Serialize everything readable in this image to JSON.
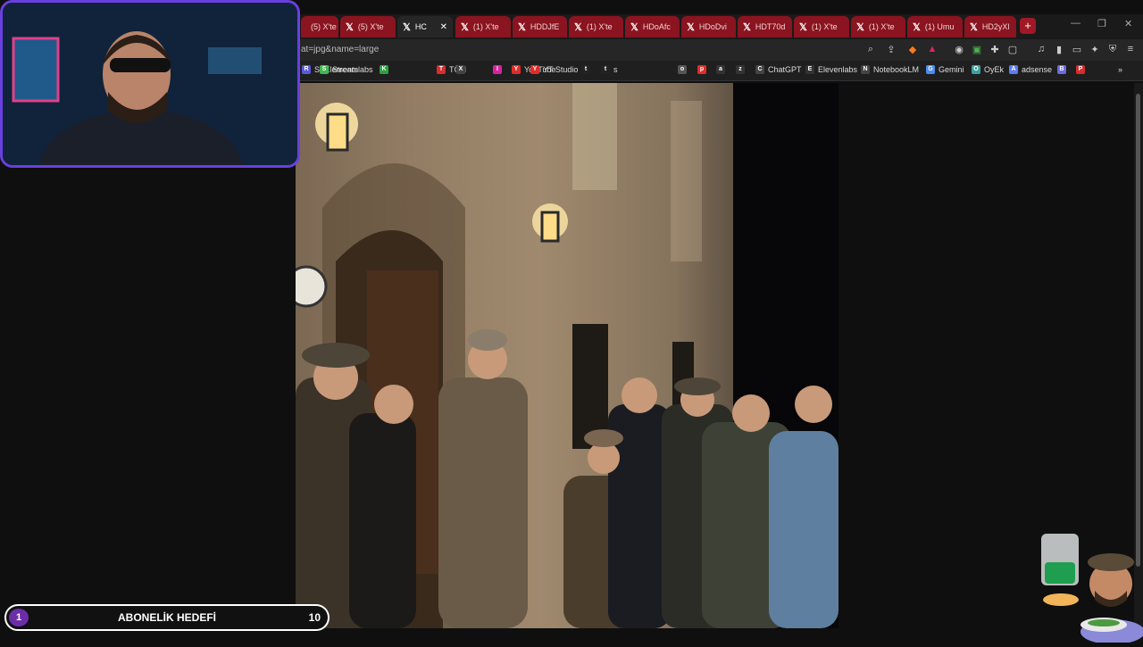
{
  "tabs": [
    {
      "label": "(5) X'te",
      "type": "red"
    },
    {
      "label": "(5) X'te",
      "type": "red"
    },
    {
      "label": "HC",
      "type": "active"
    },
    {
      "label": "(1) X'te",
      "type": "red"
    },
    {
      "label": "HDDJfE",
      "type": "red"
    },
    {
      "label": "(1) X'te",
      "type": "red"
    },
    {
      "label": "HDoAfc",
      "type": "red"
    },
    {
      "label": "HDoDvi",
      "type": "red"
    },
    {
      "label": "HDT70d",
      "type": "red"
    },
    {
      "label": "(1) X'te",
      "type": "red"
    },
    {
      "label": "(1) X'te",
      "type": "red"
    },
    {
      "label": "(1) Umu",
      "type": "red"
    },
    {
      "label": "HD2yXl",
      "type": "red"
    }
  ],
  "new_tab_label": "+",
  "url": "at=jpg&name=large",
  "bookmarks": [
    {
      "label": "STElements",
      "icon": "R"
    },
    {
      "label": "Streamlabs",
      "icon": "S"
    },
    {
      "label": "",
      "icon": "K"
    },
    {
      "label": "TÖH",
      "icon": "T"
    },
    {
      "label": "",
      "icon": "X"
    },
    {
      "label": "",
      "icon": "I"
    },
    {
      "label": "YouTube",
      "icon": "Y"
    },
    {
      "label": "YT Studio",
      "icon": "Y"
    },
    {
      "label": "",
      "icon": "t"
    },
    {
      "label": "s",
      "icon": "t"
    },
    {
      "label": "",
      "icon": "o"
    },
    {
      "label": "",
      "icon": "p"
    },
    {
      "label": "",
      "icon": "a"
    },
    {
      "label": "",
      "icon": "z"
    },
    {
      "label": "ChatGPT",
      "icon": "C"
    },
    {
      "label": "Elevenlabs",
      "icon": "E"
    },
    {
      "label": "NotebookLM",
      "icon": "N"
    },
    {
      "label": "Gemini",
      "icon": "G"
    },
    {
      "label": "OyEk",
      "icon": "O"
    },
    {
      "label": "adsense",
      "icon": "A"
    },
    {
      "label": "",
      "icon": "B"
    },
    {
      "label": "",
      "icon": "P"
    }
  ],
  "goal": {
    "current": "1",
    "title": "ABONELİK HEDEFİ",
    "target": "10"
  },
  "colors": {
    "accent": "#6a3fe0",
    "tab_red": "#8a1420",
    "goal_badge": "#6b2ea8"
  }
}
